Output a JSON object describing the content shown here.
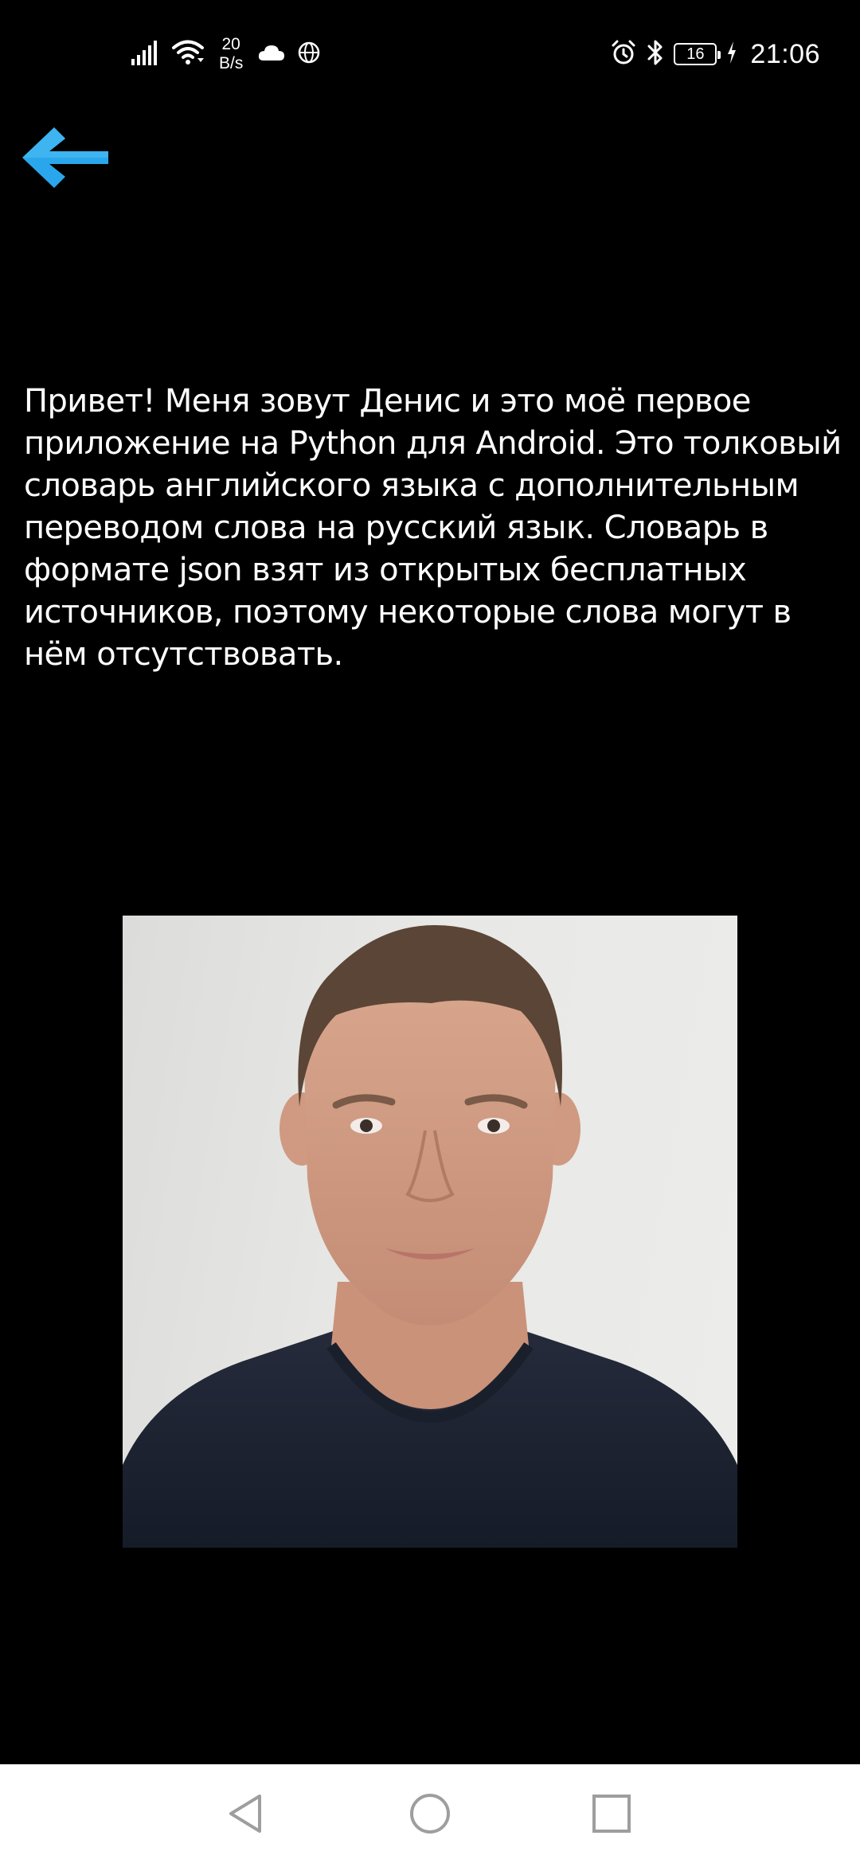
{
  "status_bar": {
    "net_speed_value": "20",
    "net_speed_unit": "B/s",
    "battery_level": "16",
    "time": "21:06",
    "icons": [
      "signal-icon",
      "wifi-icon",
      "cloud-icon",
      "globe-icon",
      "alarm-icon",
      "bluetooth-icon",
      "battery-icon",
      "charging-icon"
    ]
  },
  "toolbar": {
    "back_icon": "arrow-left-icon",
    "accent_color": "#2aa7ec"
  },
  "main": {
    "intro_text": "Привет! Меня зовут Денис и это моё первое приложение на Python для Android. Это толковый словарь английского языка с дополнительным переводом слова на русский язык. Словарь в формате json взят из открытых бесплатных источников, поэтому некоторые слова могут в нём отсутствовать.",
    "photo": "author-portrait"
  },
  "nav_bar": {
    "buttons": [
      "back-triangle-icon",
      "home-circle-icon",
      "recents-square-icon"
    ]
  }
}
